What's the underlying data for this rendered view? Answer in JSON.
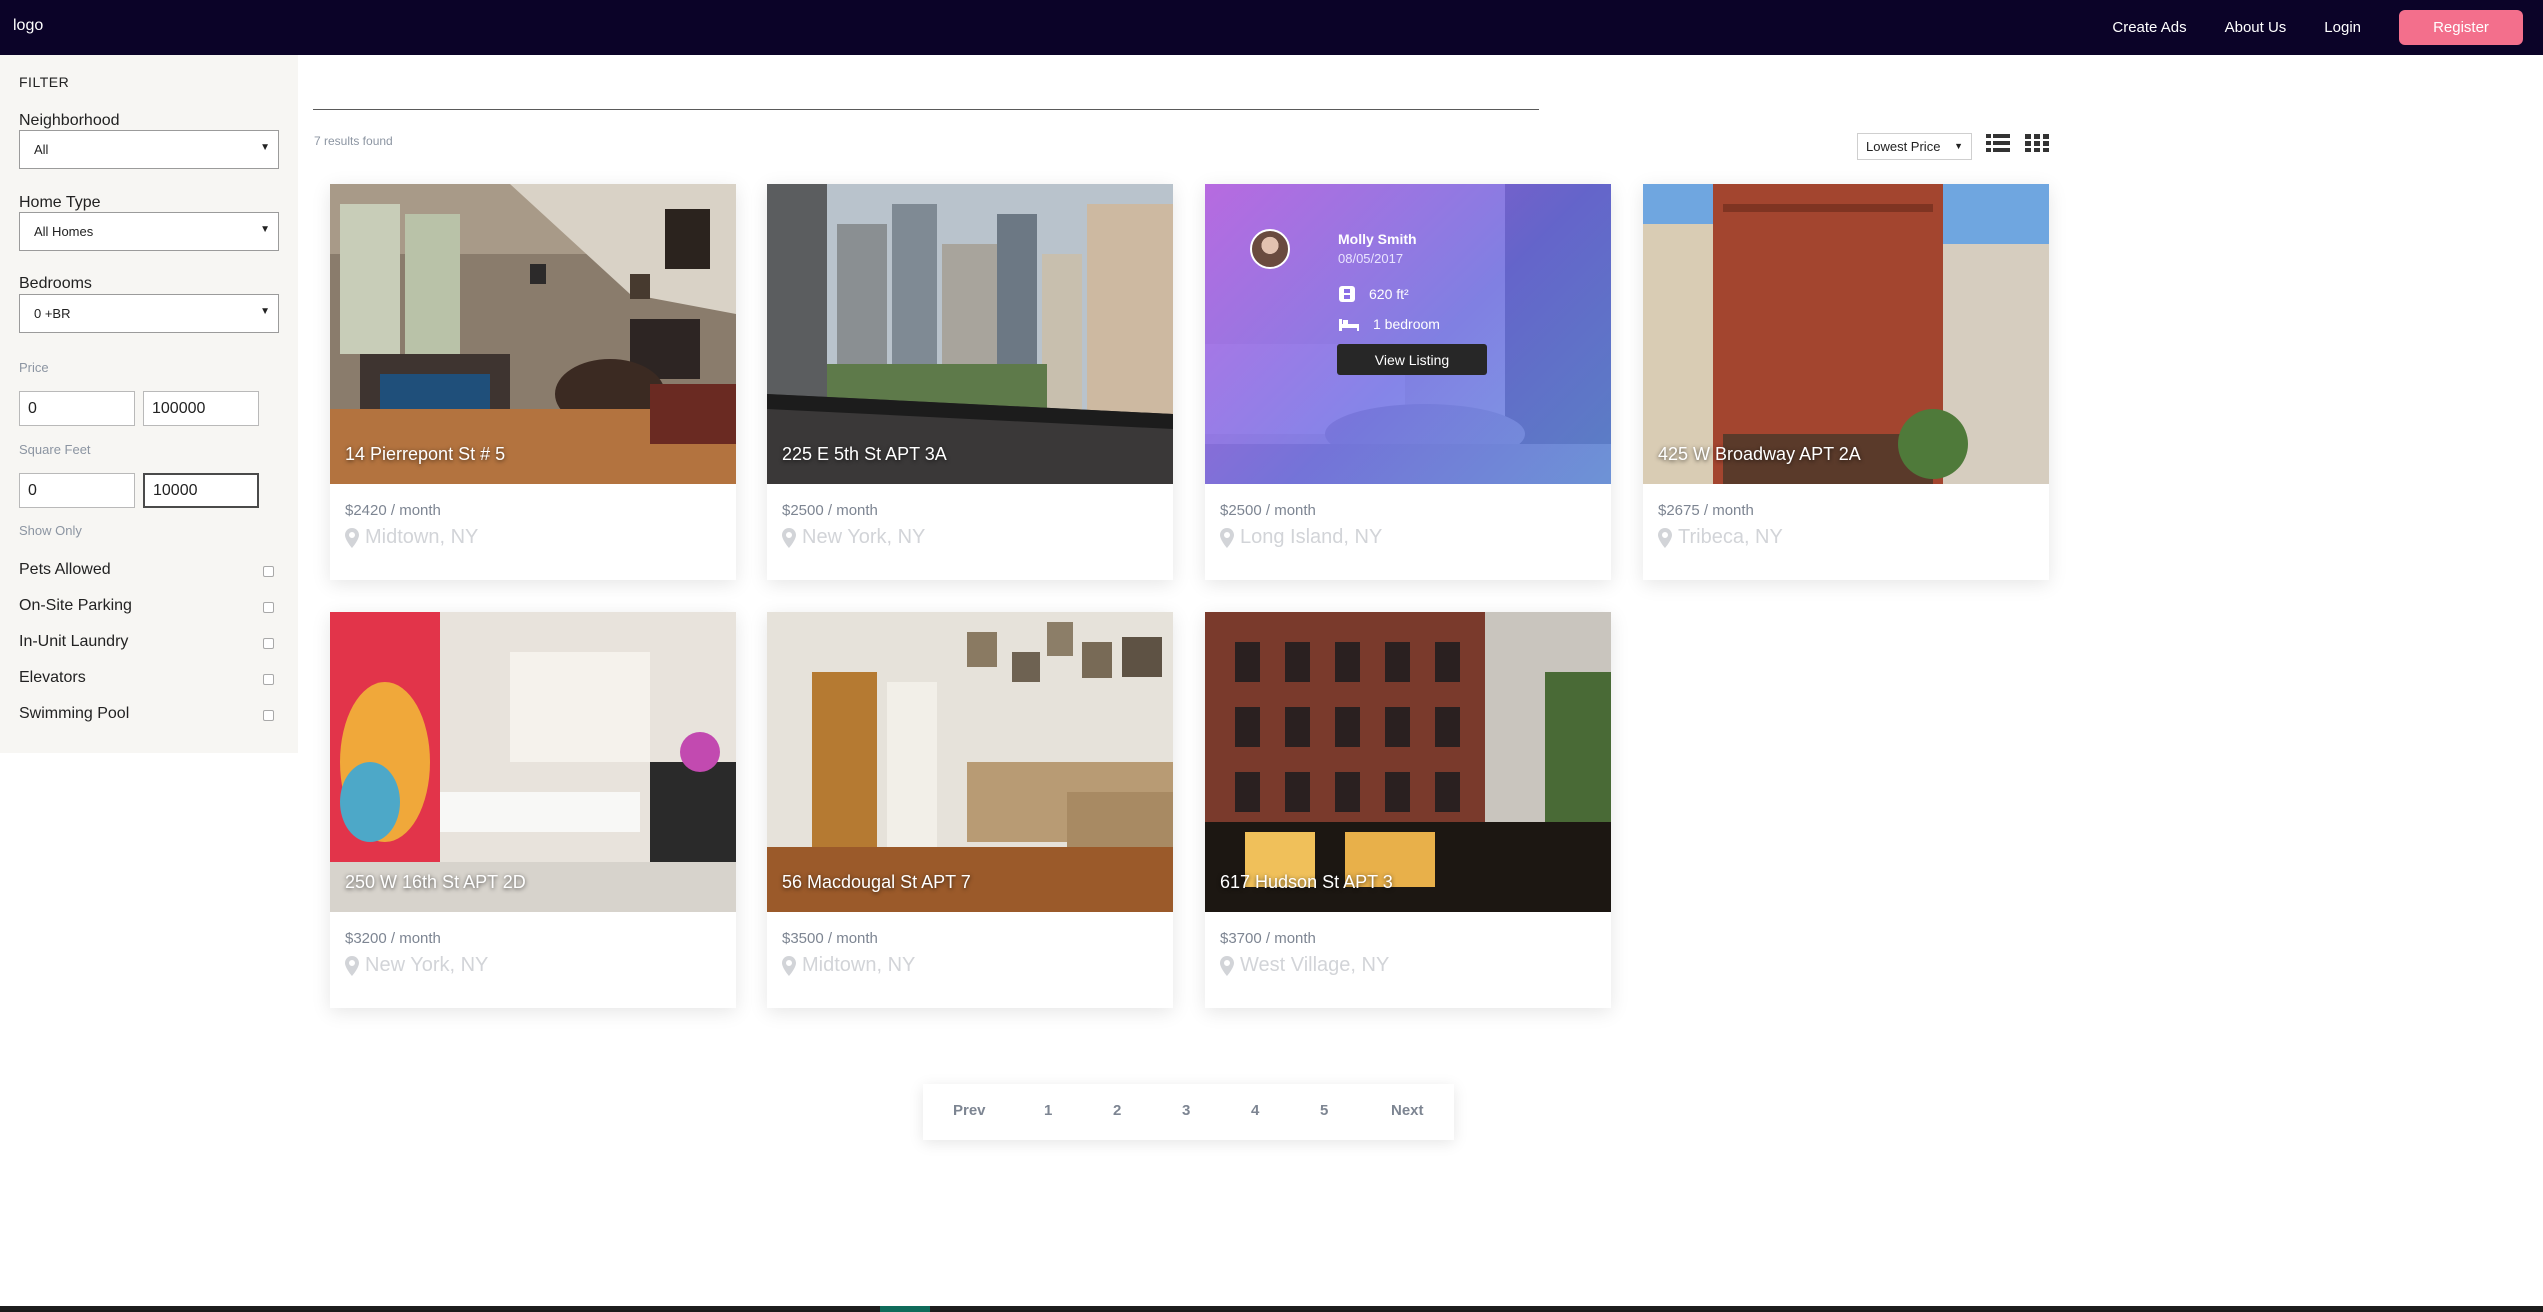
{
  "header": {
    "logo": "logo",
    "nav": [
      "Create Ads",
      "About Us",
      "Login"
    ],
    "register": "Register"
  },
  "filter": {
    "title": "FILTER",
    "neighborhood": {
      "label": "Neighborhood",
      "value": "All"
    },
    "home_type": {
      "label": "Home Type",
      "value": "All Homes"
    },
    "bedrooms": {
      "label": "Bedrooms",
      "value": "0 +BR"
    },
    "price": {
      "label": "Price",
      "min": "0",
      "max": "100000"
    },
    "sqft": {
      "label": "Square Feet",
      "min": "0",
      "max": "10000"
    },
    "show_only": "Show Only",
    "options": [
      "Pets Allowed",
      "On-Site Parking",
      "In-Unit Laundry",
      "Elevators",
      "Swimming Pool"
    ]
  },
  "results": {
    "count": "7 results found",
    "sort": "Lowest Price"
  },
  "listings": [
    {
      "title": "14 Pierrepont St # 5",
      "price": "$2420 / month",
      "location": "Midtown, NY"
    },
    {
      "title": "225 E 5th St APT 3A",
      "price": "$2500 / month",
      "location": "New York, NY"
    },
    {
      "title": "",
      "price": "$2500 / month",
      "location": "Long Island, NY",
      "overlay": {
        "name": "Molly Smith",
        "date": "08/05/2017",
        "sqft": "620 ft²",
        "bedrooms": "1 bedroom",
        "button": "View Listing"
      }
    },
    {
      "title": "425 W Broadway APT 2A",
      "price": "$2675 / month",
      "location": "Tribeca, NY"
    },
    {
      "title": "250 W 16th St APT 2D",
      "price": "$3200 / month",
      "location": "New York, NY"
    },
    {
      "title": "56 Macdougal St APT 7",
      "price": "$3500 / month",
      "location": "Midtown, NY"
    },
    {
      "title": "617 Hudson St APT 3",
      "price": "$3700 / month",
      "location": "West Village, NY"
    }
  ],
  "pagination": {
    "prev": "Prev",
    "pages": [
      "1",
      "2",
      "3",
      "4",
      "5"
    ],
    "next": "Next"
  },
  "colors": {
    "header_bg": "#0b0328",
    "register": "#f36f8c",
    "overlay": "#8a6ee6"
  }
}
